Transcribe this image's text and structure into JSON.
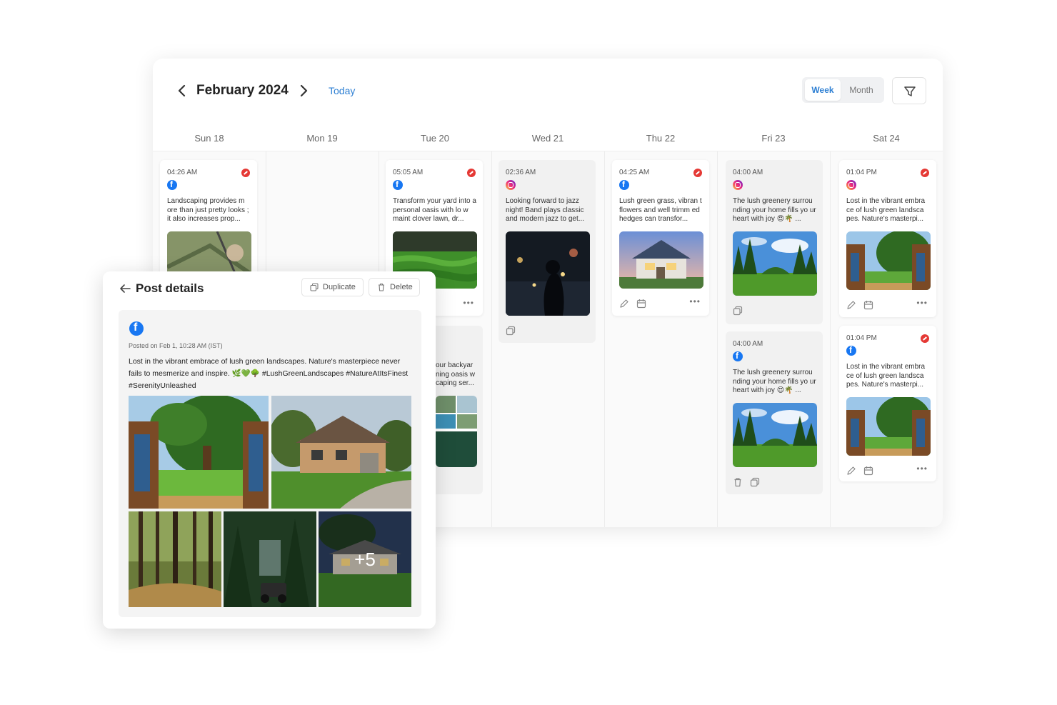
{
  "calendar": {
    "month_title": "February 2024",
    "today_label": "Today",
    "views": {
      "week": "Week",
      "month": "Month"
    },
    "days": [
      "Sun 18",
      "Mon 19",
      "Tue 20",
      "Wed 21",
      "Thu 22",
      "Fri 23",
      "Sat 24"
    ],
    "posts": {
      "sun_1": {
        "time": "04:26 AM",
        "platform": "facebook",
        "text": "Landscaping provides m ore than just pretty looks ; it also increases prop..."
      },
      "tue_1": {
        "time": "05:05 AM",
        "platform": "facebook",
        "text": "Transform your yard into a personal oasis with lo w maint clover lawn, dr..."
      },
      "tue_2": {
        "text": "our backyar ning oasis w caping ser..."
      },
      "wed_1": {
        "time": "02:36 AM",
        "platform": "instagram",
        "text": "Looking forward to jazz night! Band plays classic and modern jazz to get..."
      },
      "thu_1": {
        "time": "04:25 AM",
        "platform": "facebook",
        "text": "Lush green grass, vibran t flowers and well trimm ed hedges can transfor..."
      },
      "fri_1": {
        "time": "04:00 AM",
        "platform": "instagram",
        "text": "The lush greenery surrou nding your home fills yo ur heart with joy 😍🌴 ..."
      },
      "fri_2": {
        "time": "04:00 AM",
        "platform": "facebook",
        "text": "The lush greenery surrou nding your home fills yo ur heart with joy 😍🌴 ..."
      },
      "sat_1": {
        "time": "01:04 PM",
        "platform": "instagram",
        "text": "Lost in the vibrant embra ce of lush green landsca pes. Nature's masterpi..."
      },
      "sat_2": {
        "time": "01:04 PM",
        "platform": "facebook",
        "text": "Lost in the vibrant embra ce of lush green landsca pes. Nature's masterpi..."
      }
    }
  },
  "details": {
    "title": "Post details",
    "duplicate_label": "Duplicate",
    "delete_label": "Delete",
    "platform": "facebook",
    "posted_on": "Posted on Feb 1, 10:28 AM (IST)",
    "text": "Lost in the vibrant embrace of lush green landscapes. Nature's masterpiece never fails to mesmerize and inspire. 🌿💚🌳 #LushGreenLandscapes #NatureAtItsFinest #SerenityUnleashed",
    "more_images": "+5"
  },
  "colors": {
    "accent": "#2d7fd3",
    "facebook": "#1877f2",
    "error": "#e53935"
  }
}
